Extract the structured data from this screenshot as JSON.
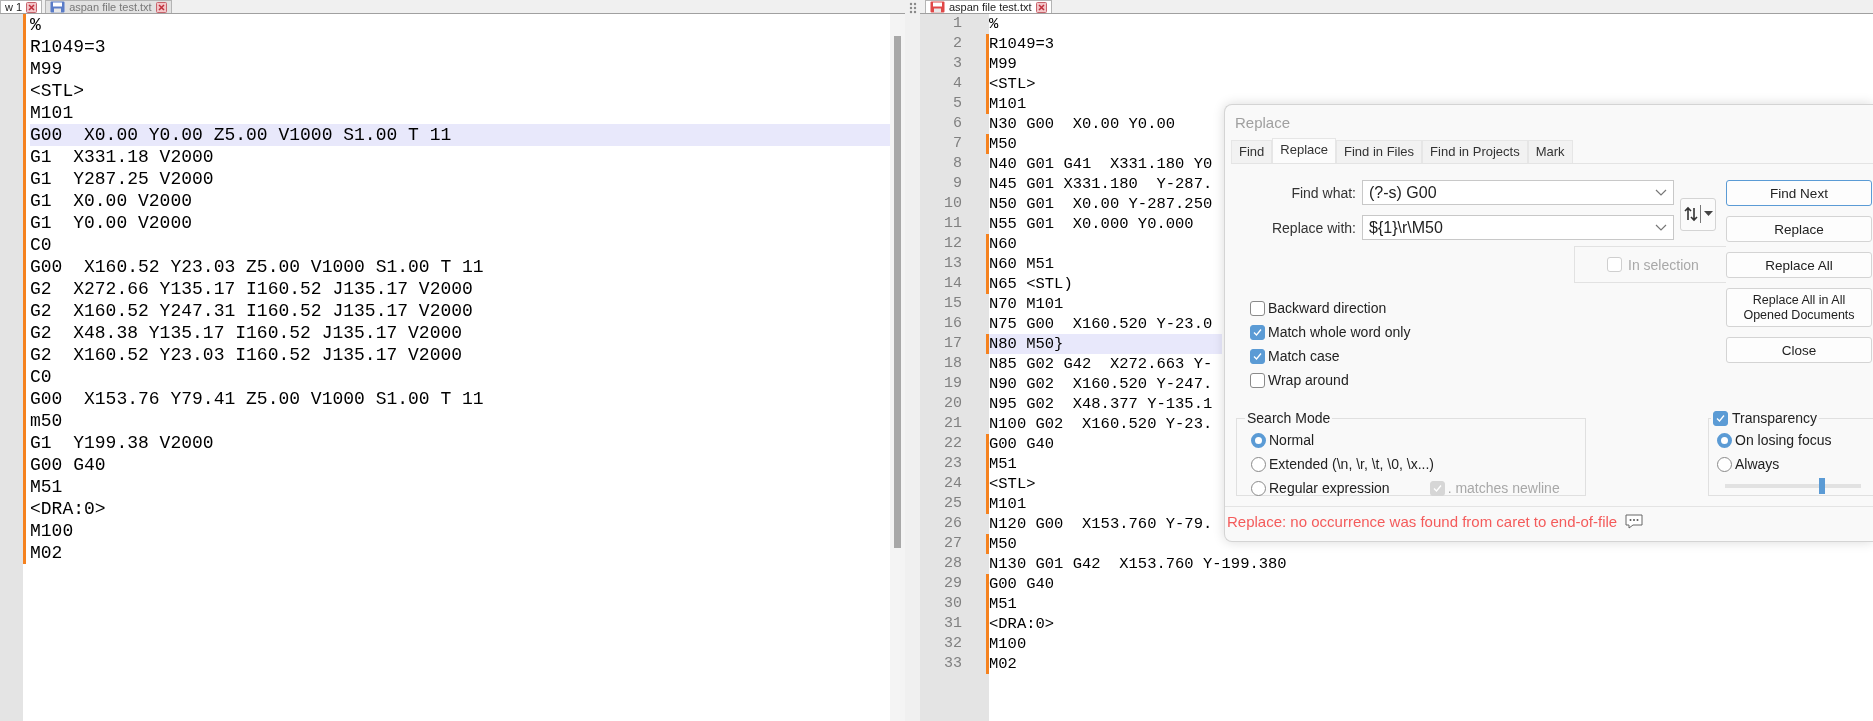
{
  "left_pane": {
    "tabs": [
      {
        "label": "w 1",
        "selected": true
      },
      {
        "label": "aspan file test.txt",
        "selected": false,
        "modified": false
      }
    ],
    "lines": [
      {
        "text": "%",
        "changed": true,
        "current": false
      },
      {
        "text": "R1049=3",
        "changed": true,
        "current": false
      },
      {
        "text": "M99",
        "changed": true,
        "current": false
      },
      {
        "text": "<STL>",
        "changed": true,
        "current": false
      },
      {
        "text": "M101",
        "changed": true,
        "current": false
      },
      {
        "text": "G00  X0.00 Y0.00 Z5.00 V1000 S1.00 T 11",
        "changed": true,
        "current": true
      },
      {
        "text": "G1  X331.18 V2000",
        "changed": true,
        "current": false
      },
      {
        "text": "G1  Y287.25 V2000",
        "changed": true,
        "current": false
      },
      {
        "text": "G1  X0.00 V2000",
        "changed": true,
        "current": false
      },
      {
        "text": "G1  Y0.00 V2000",
        "changed": true,
        "current": false
      },
      {
        "text": "C0",
        "changed": true,
        "current": false
      },
      {
        "text": "G00  X160.52 Y23.03 Z5.00 V1000 S1.00 T 11",
        "changed": true,
        "current": false
      },
      {
        "text": "G2  X272.66 Y135.17 I160.52 J135.17 V2000",
        "changed": true,
        "current": false
      },
      {
        "text": "G2  X160.52 Y247.31 I160.52 J135.17 V2000",
        "changed": true,
        "current": false
      },
      {
        "text": "G2  X48.38 Y135.17 I160.52 J135.17 V2000",
        "changed": true,
        "current": false
      },
      {
        "text": "G2  X160.52 Y23.03 I160.52 J135.17 V2000",
        "changed": true,
        "current": false
      },
      {
        "text": "C0",
        "changed": true,
        "current": false
      },
      {
        "text": "G00  X153.76 Y79.41 Z5.00 V1000 S1.00 T 11",
        "changed": true,
        "current": false
      },
      {
        "text": "m50",
        "changed": true,
        "current": false
      },
      {
        "text": "G1  Y199.38 V2000",
        "changed": true,
        "current": false
      },
      {
        "text": "G00 G40",
        "changed": true,
        "current": false
      },
      {
        "text": "M51",
        "changed": true,
        "current": false
      },
      {
        "text": "<DRA:0>",
        "changed": true,
        "current": false
      },
      {
        "text": "M100",
        "changed": true,
        "current": false
      },
      {
        "text": "M02",
        "changed": true,
        "current": false
      }
    ]
  },
  "right_pane": {
    "tabs": [
      {
        "label": "aspan file test.txt",
        "selected": true,
        "modified": true
      }
    ],
    "lines": [
      {
        "number": "1",
        "text": "%",
        "changed": false,
        "current": false
      },
      {
        "number": "2",
        "text": "R1049=3",
        "changed": true,
        "current": false
      },
      {
        "number": "3",
        "text": "M99",
        "changed": true,
        "current": false
      },
      {
        "number": "4",
        "text": "<STL>",
        "changed": true,
        "current": false
      },
      {
        "number": "5",
        "text": "M101",
        "changed": true,
        "current": false
      },
      {
        "number": "6",
        "text": "N30 G00  X0.00 Y0.00",
        "changed": false,
        "current": false
      },
      {
        "number": "7",
        "text": "M50",
        "changed": true,
        "current": false
      },
      {
        "number": "8",
        "text": "N40 G01 G41  X331.180 Y0",
        "changed": false,
        "current": false
      },
      {
        "number": "9",
        "text": "N45 G01 X331.180  Y-287.",
        "changed": false,
        "current": false
      },
      {
        "number": "10",
        "text": "N50 G01  X0.00 Y-287.250",
        "changed": false,
        "current": false
      },
      {
        "number": "11",
        "text": "N55 G01  X0.000 Y0.000",
        "changed": false,
        "current": false
      },
      {
        "number": "12",
        "text": "N60",
        "changed": true,
        "current": false
      },
      {
        "number": "13",
        "text": "N60 M51",
        "changed": true,
        "current": false
      },
      {
        "number": "14",
        "text": "N65 <STL)",
        "changed": true,
        "current": false
      },
      {
        "number": "15",
        "text": "N70 M101",
        "changed": false,
        "current": false
      },
      {
        "number": "16",
        "text": "N75 G00  X160.520 Y-23.0",
        "changed": false,
        "current": false
      },
      {
        "number": "17",
        "text": "N80 M50}",
        "changed": true,
        "current": true
      },
      {
        "number": "18",
        "text": "N85 G02 G42  X272.663 Y-",
        "changed": false,
        "current": false
      },
      {
        "number": "19",
        "text": "N90 G02  X160.520 Y-247.",
        "changed": false,
        "current": false
      },
      {
        "number": "20",
        "text": "N95 G02  X48.377 Y-135.1",
        "changed": false,
        "current": false
      },
      {
        "number": "21",
        "text": "N100 G02  X160.520 Y-23.",
        "changed": false,
        "current": false
      },
      {
        "number": "22",
        "text": "G00 G40",
        "changed": true,
        "current": false
      },
      {
        "number": "23",
        "text": "M51",
        "changed": true,
        "current": false
      },
      {
        "number": "24",
        "text": "<STL>",
        "changed": true,
        "current": false
      },
      {
        "number": "25",
        "text": "M101",
        "changed": true,
        "current": false
      },
      {
        "number": "26",
        "text": "N120 G00  X153.760 Y-79.",
        "changed": false,
        "current": false
      },
      {
        "number": "27",
        "text": "M50",
        "changed": true,
        "current": false
      },
      {
        "number": "28",
        "text": "N130 G01 G42  X153.760 Y-199.380",
        "changed": false,
        "current": false
      },
      {
        "number": "29",
        "text": "G00 G40",
        "changed": true,
        "current": false
      },
      {
        "number": "30",
        "text": "M51",
        "changed": true,
        "current": false
      },
      {
        "number": "31",
        "text": "<DRA:0>",
        "changed": true,
        "current": false
      },
      {
        "number": "32",
        "text": "M100",
        "changed": true,
        "current": false
      },
      {
        "number": "33",
        "text": "M02",
        "changed": true,
        "current": false
      }
    ]
  },
  "replace_dialog": {
    "title": "Replace",
    "tabs": [
      {
        "label": "Find",
        "selected": false
      },
      {
        "label": "Replace",
        "selected": true
      },
      {
        "label": "Find in Files",
        "selected": false
      },
      {
        "label": "Find in Projects",
        "selected": false
      },
      {
        "label": "Mark",
        "selected": false
      }
    ],
    "fields": [
      {
        "label": "Find what:",
        "value": "(?-s) G00"
      },
      {
        "label": "Replace with:",
        "value": "${1}\\r\\M50"
      }
    ],
    "buttons": [
      {
        "label": "Find Next",
        "focused": true
      },
      {
        "label": "Replace",
        "focused": false
      },
      {
        "label": "Replace All",
        "focused": false
      },
      {
        "label": "Replace All in All Opened Documents",
        "focused": false
      },
      {
        "label": "Close",
        "focused": false
      }
    ],
    "in_selection": {
      "label": "In selection",
      "checked": false,
      "disabled": true
    },
    "options": [
      {
        "label": "Backward direction",
        "checked": false
      },
      {
        "label": "Match whole word only",
        "checked": true
      },
      {
        "label": "Match case",
        "checked": true
      },
      {
        "label": "Wrap around",
        "checked": false
      }
    ],
    "search_mode": {
      "title": "Search Mode",
      "modes": [
        {
          "label": "Normal",
          "selected": true
        },
        {
          "label": "Extended (\\n, \\r, \\t, \\0, \\x...)",
          "selected": false
        },
        {
          "label": "Regular expression",
          "selected": false
        }
      ],
      "matches_newline": {
        "label": ". matches newline",
        "checked": true,
        "disabled": true
      }
    },
    "transparency": {
      "label": "Transparency",
      "checked": true,
      "modes": [
        {
          "label": "On losing focus",
          "selected": true
        },
        {
          "label": "Always",
          "selected": false
        }
      ],
      "level": 0.71
    },
    "status": "Replace: no occurrence was found from caret to end-of-file"
  }
}
